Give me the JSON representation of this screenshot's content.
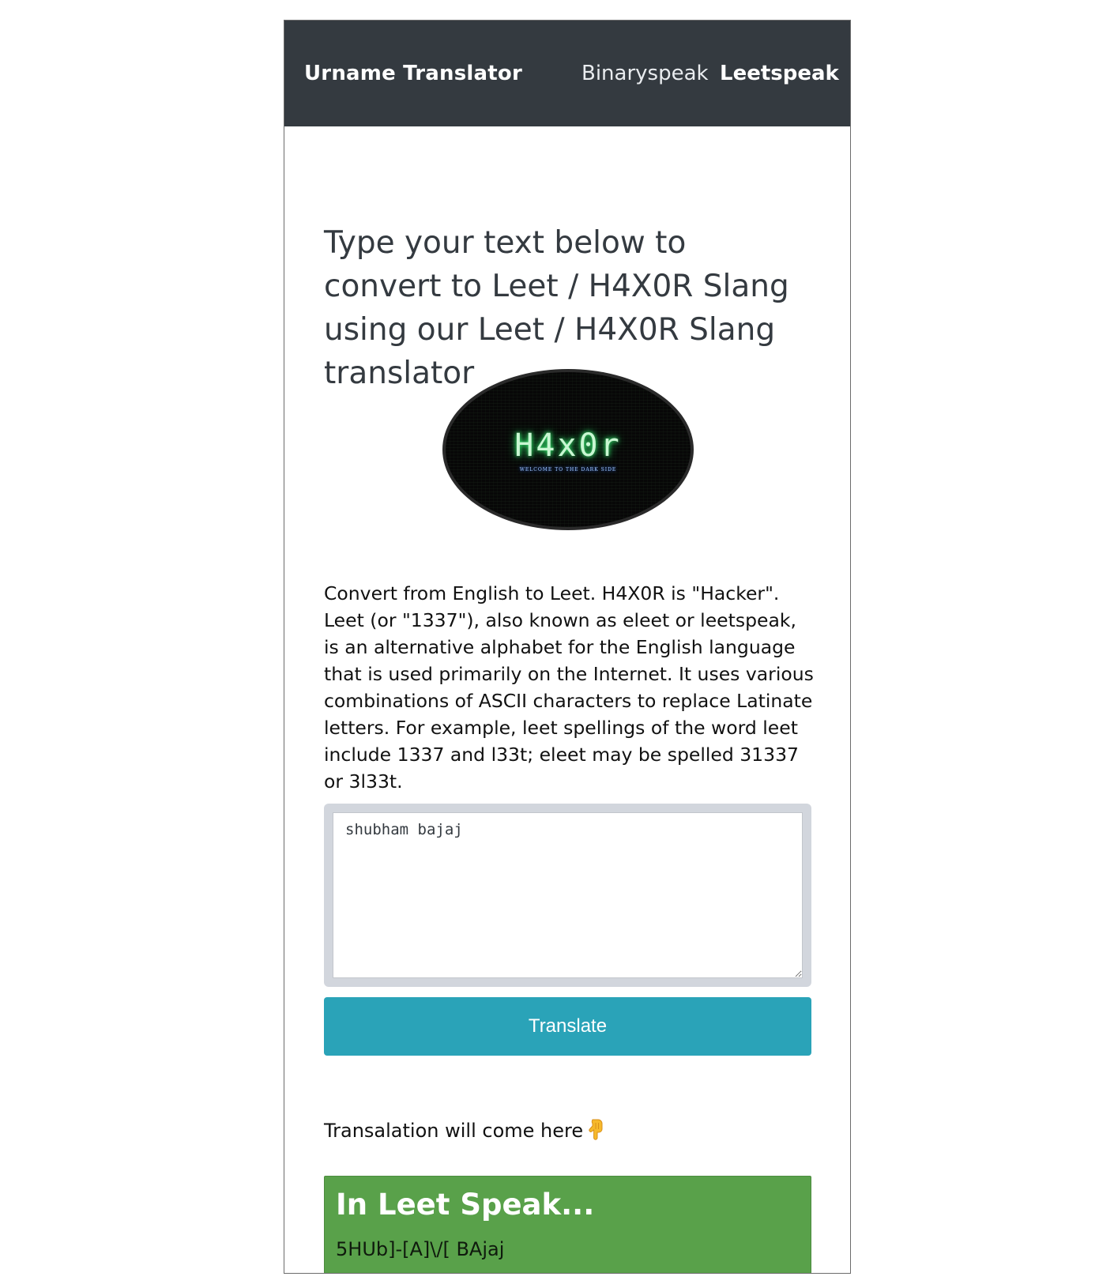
{
  "navbar": {
    "brand": "Urname Translator",
    "links": [
      {
        "label": "Binaryspeak"
      },
      {
        "label": "Leetspeak"
      }
    ]
  },
  "main": {
    "heading": "Type your text below to convert to Leet / H4X0R Slang using our Leet / H4X0R Slang translator",
    "hero": {
      "title": "H4x0r",
      "subtitle": "WELCOME TO THE DARK SIDE"
    },
    "description": "Convert from English to Leet. H4X0R is \"Hacker\". Leet (or \"1337\"), also known as eleet or leetspeak, is an alternative alphabet for the English language that is used primarily on the Internet. It uses various combinations of ASCII characters to replace Latinate letters. For example, leet spellings of the word leet include 1337 and l33t; eleet may be spelled 31337 or 3l33t.",
    "input": {
      "value": "shubham bajaj"
    },
    "translate_label": "Translate",
    "hint": "Transalation will come here",
    "hint_icon": "pointing-down-hand-icon",
    "result": {
      "title": "In Leet Speak...",
      "text": "5HUb]-[A]\\/[ BAjaj"
    }
  },
  "colors": {
    "navbar_bg": "#343a40",
    "button_bg": "#2aa3b8",
    "result_bg": "#59a14a"
  }
}
